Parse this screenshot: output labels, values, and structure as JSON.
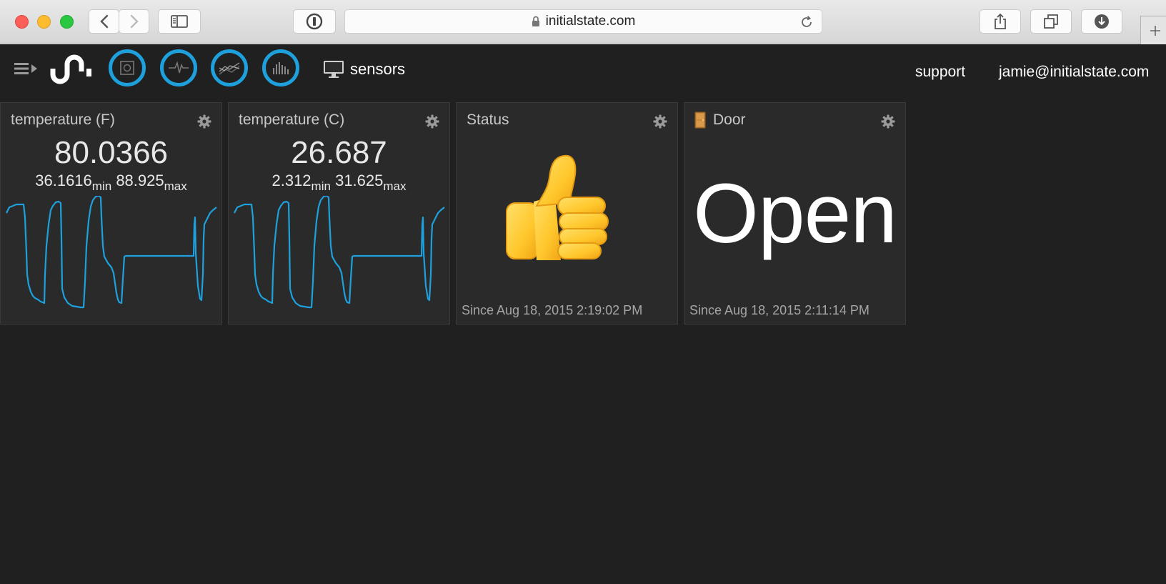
{
  "browser": {
    "url": "initialstate.com"
  },
  "nav": {
    "bucket_label": "sensors",
    "support_label": "support",
    "user_email": "jamie@initialstate.com",
    "accent_color": "#1ea0dc",
    "views": [
      {
        "icon": "tiles-view-icon"
      },
      {
        "icon": "waves-view-icon"
      },
      {
        "icon": "lines-view-icon"
      },
      {
        "icon": "bars-view-icon"
      }
    ]
  },
  "tiles": [
    {
      "title": "temperature (F)",
      "value": "80.0366",
      "min": "36.1616",
      "min_label": "min",
      "max": "88.925",
      "max_label": "max",
      "line_color": "#1ea0dc"
    },
    {
      "title": "temperature (C)",
      "value": "26.687",
      "min": "2.312",
      "min_label": "min",
      "max": "31.625",
      "max_label": "max",
      "line_color": "#1ea0dc"
    },
    {
      "title": "Status",
      "icon": "thumbs-up-emoji",
      "since": "Since Aug 18, 2015 2:19:02 PM"
    },
    {
      "title": "Door",
      "icon": "door-emoji",
      "state": "Open",
      "since": "Since Aug 18, 2015 2:11:14 PM"
    }
  ]
}
